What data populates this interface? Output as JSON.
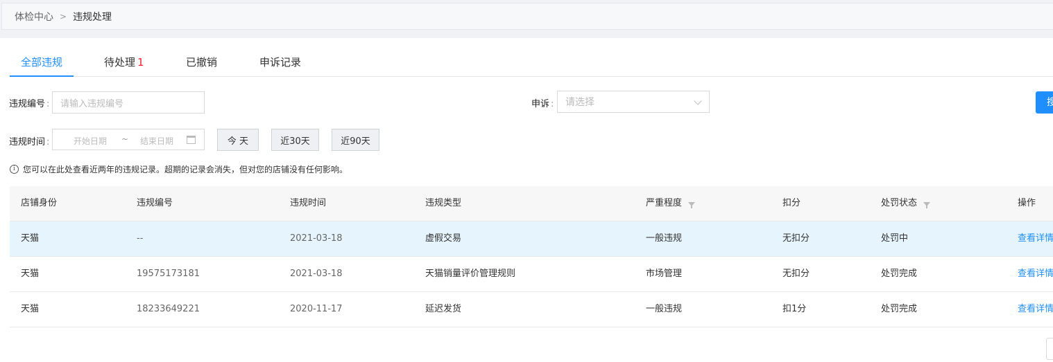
{
  "breadcrumb": {
    "home": "体检中心",
    "separator": ">",
    "current": "违规处理"
  },
  "tabs": [
    {
      "label": "全部违规",
      "active": true
    },
    {
      "label": "待处理",
      "badge": "1"
    },
    {
      "label": "已撤销"
    },
    {
      "label": "申诉记录"
    }
  ],
  "filters": {
    "violation_no": {
      "label": "违规编号",
      "placeholder": "请输入违规编号"
    },
    "appeal": {
      "label": "申诉",
      "placeholder": "请选择"
    },
    "violation_time": {
      "label": "违规时间",
      "start_placeholder": "开始日期",
      "tilde": "~",
      "end_placeholder": "结束日期"
    },
    "quick": [
      "今 天",
      "近30天",
      "近90天"
    ],
    "search_label": "搜"
  },
  "tip": "您可以在此处查看近两年的违规记录。超期的记录会消失，但对您的店铺没有任何影响。",
  "table": {
    "headers": [
      "店铺身份",
      "违规编号",
      "违规时间",
      "违规类型",
      "严重程度",
      "扣分",
      "处罚状态",
      "操作"
    ],
    "rows": [
      {
        "identity": "天猫",
        "no": "--",
        "time": "2021-03-18",
        "type": "虚假交易",
        "severity": "一般违规",
        "points": "无扣分",
        "status": "处罚中",
        "action": "查看详情"
      },
      {
        "identity": "天猫",
        "no": "19575173181",
        "time": "2021-03-18",
        "type": "天猫销量评价管理规则",
        "severity": "市场管理",
        "points": "无扣分",
        "status": "处罚完成",
        "action": "查看详情"
      },
      {
        "identity": "天猫",
        "no": "18233649221",
        "time": "2020-11-17",
        "type": "延迟发货",
        "severity": "一般违规",
        "points": "扣1分",
        "status": "处罚完成",
        "action": "查看详情"
      }
    ]
  },
  "colors": {
    "accent": "#1f8fff",
    "badge": "#f5222d",
    "highlight_row": "#e6f4fd"
  }
}
